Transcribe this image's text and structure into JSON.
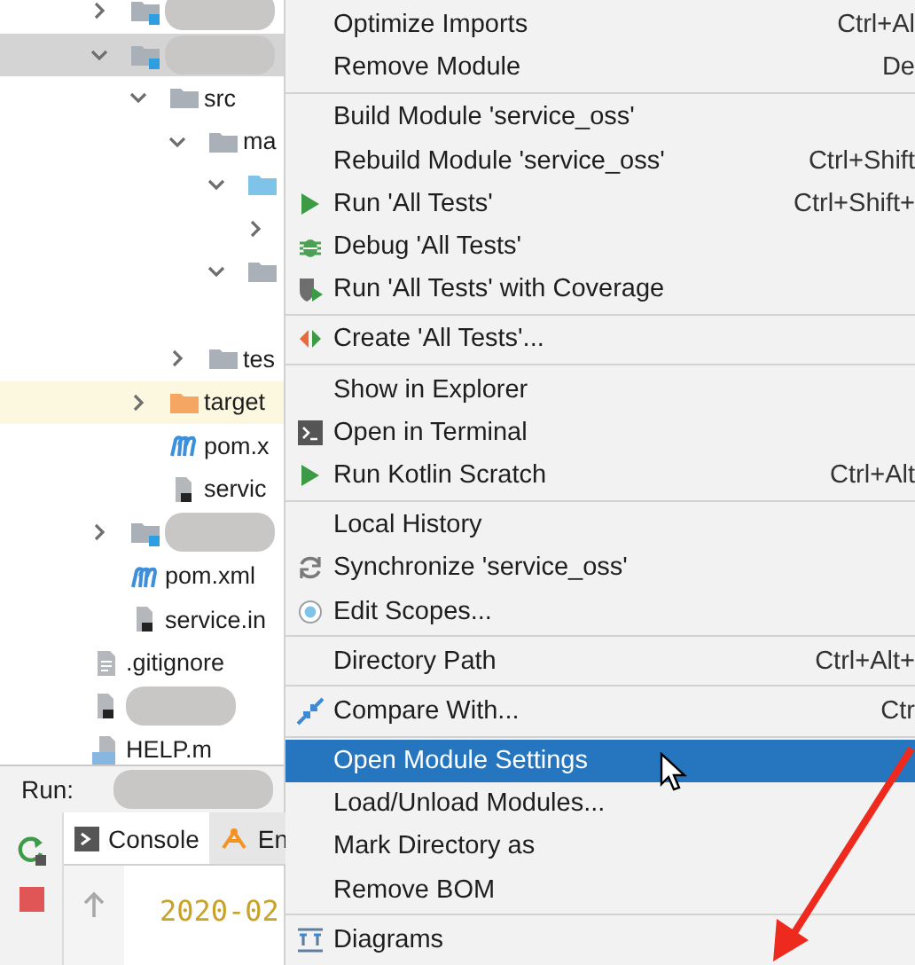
{
  "project_tree": {
    "items": [
      {
        "kind": "module",
        "blurred": true,
        "expanded": false,
        "selected": false
      },
      {
        "kind": "module",
        "blurred": true,
        "expanded": true,
        "selected": true,
        "children": [
          {
            "kind": "folder",
            "label": "src",
            "expanded": true,
            "selected": false,
            "children": [
              {
                "kind": "folder",
                "label": "ma",
                "expanded": true,
                "selected": false,
                "children": [
                  {
                    "kind": "source",
                    "expanded": true,
                    "selected": false,
                    "children": [
                      {
                        "kind": "folder",
                        "expanded": false,
                        "selected": false
                      }
                    ]
                  },
                  {
                    "kind": "folder",
                    "expanded": true,
                    "selected": false,
                    "children": [
                      {
                        "kind": "blank"
                      }
                    ]
                  }
                ]
              },
              {
                "kind": "folder",
                "label": "tes",
                "expanded": false,
                "selected": false
              }
            ]
          },
          {
            "kind": "excluded",
            "label": "target",
            "expanded": false,
            "selected": false
          },
          {
            "kind": "maven",
            "label": "pom.x",
            "selected": false
          },
          {
            "kind": "config",
            "label": "servic",
            "selected": false
          }
        ]
      },
      {
        "kind": "module",
        "blurred": true,
        "expanded": false,
        "selected": false
      },
      {
        "kind": "maven",
        "label": "pom.xml",
        "selected": false
      },
      {
        "kind": "config",
        "label": "service.in",
        "selected": false
      }
    ],
    "outer_items": [
      {
        "kind": "text",
        "label": ".gitignore",
        "selected": false
      },
      {
        "kind": "config",
        "blurred": true,
        "selected": false
      },
      {
        "kind": "markdown",
        "label": "HELP.m",
        "selected": false
      }
    ]
  },
  "run_panel": {
    "label": "Run:",
    "tabs": [
      {
        "label": "Console",
        "kind": "console",
        "selected": true
      },
      {
        "label": "En",
        "kind": "endpoints",
        "selected": false
      }
    ],
    "console_lines": [
      "2020-02"
    ]
  },
  "context_menu": {
    "groups": [
      [
        {
          "label": "Optimize Imports",
          "shortcut": "Ctrl+Al",
          "kind": "plain",
          "selected": false
        },
        {
          "label": "Remove Module",
          "shortcut": "De",
          "kind": "plain",
          "selected": false
        }
      ],
      [
        {
          "label": "Build Module 'service_oss'",
          "kind": "plain",
          "selected": false
        },
        {
          "label": "Rebuild Module 'service_oss'",
          "shortcut": "Ctrl+Shift",
          "kind": "plain",
          "selected": false
        },
        {
          "label": "Run 'All Tests'",
          "shortcut": "Ctrl+Shift+",
          "kind": "run",
          "selected": false
        },
        {
          "label": "Debug 'All Tests'",
          "kind": "debug",
          "selected": false
        },
        {
          "label": "Run 'All Tests' with Coverage",
          "kind": "coverage",
          "selected": false
        }
      ],
      [
        {
          "label": "Create 'All Tests'...",
          "kind": "create",
          "selected": false
        }
      ],
      [
        {
          "label": "Show in Explorer",
          "kind": "plain",
          "selected": false
        },
        {
          "label": "Open in Terminal",
          "kind": "terminal",
          "selected": false
        },
        {
          "label": "Run Kotlin Scratch",
          "shortcut": "Ctrl+Alt",
          "kind": "run",
          "selected": false
        }
      ],
      [
        {
          "label": "Local History",
          "kind": "plain",
          "selected": false
        },
        {
          "label": "Synchronize 'service_oss'",
          "kind": "sync",
          "selected": false
        },
        {
          "label": "Edit Scopes...",
          "kind": "scopes",
          "selected": false
        }
      ],
      [
        {
          "label": "Directory Path",
          "shortcut": "Ctrl+Alt+",
          "kind": "plain",
          "selected": false
        }
      ],
      [
        {
          "label": "Compare With...",
          "shortcut": "Ctr",
          "kind": "compare",
          "selected": false
        }
      ],
      [
        {
          "label": "Open Module Settings",
          "kind": "plain",
          "selected": true
        },
        {
          "label": "Load/Unload Modules...",
          "kind": "plain",
          "selected": false
        },
        {
          "label": "Mark Directory as",
          "kind": "plain",
          "selected": false
        },
        {
          "label": "Remove BOM",
          "kind": "plain",
          "selected": false
        }
      ],
      [
        {
          "label": "Diagrams",
          "kind": "diagrams",
          "selected": false
        }
      ]
    ]
  }
}
